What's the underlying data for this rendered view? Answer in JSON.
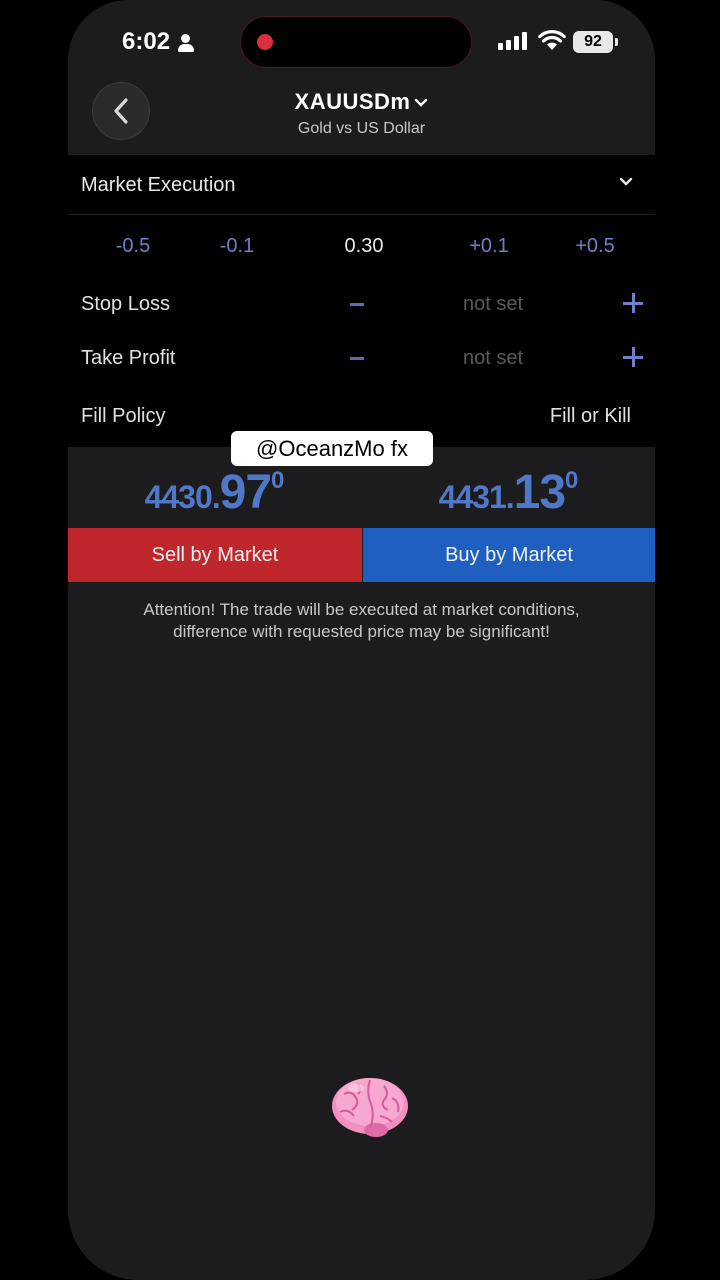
{
  "status_bar": {
    "time": "6:02",
    "battery": "92"
  },
  "header": {
    "symbol": "XAUUSDm",
    "description": "Gold vs US Dollar"
  },
  "order": {
    "execution_type": "Market Execution",
    "volume_steps": [
      "-0.5",
      "-0.1",
      "0.30",
      "+0.1",
      "+0.5"
    ],
    "stop_loss": {
      "label": "Stop Loss",
      "value": "not set"
    },
    "take_profit": {
      "label": "Take Profit",
      "value": "not set"
    },
    "fill_policy": {
      "label": "Fill Policy",
      "value": "Fill or Kill"
    }
  },
  "watermark": "@OceanzMo fx",
  "prices": {
    "bid": {
      "main": "4430.",
      "big": "97",
      "sup": "0"
    },
    "ask": {
      "main": "4431.",
      "big": "13",
      "sup": "0"
    }
  },
  "buttons": {
    "sell": "Sell by Market",
    "buy": "Buy by Market"
  },
  "attention": {
    "line1": "Attention! The trade will be executed at market conditions,",
    "line2": "difference with requested price may be significant!"
  },
  "colors": {
    "sell": "#c0272d",
    "buy": "#1f5fbf",
    "accent": "#6f7fc8",
    "price": "#4f78c8"
  },
  "icons": {
    "back": "chevron-left-icon",
    "brain": "brain-emoji-icon"
  }
}
